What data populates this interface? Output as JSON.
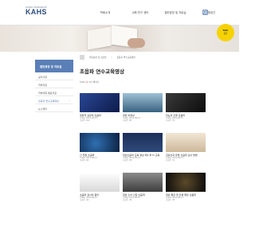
{
  "header": {
    "logo_sub": "KOREA AEROSPACE",
    "logo_main": "KAHS",
    "nav": [
      "학회소개",
      "교육·연구 센터",
      "열린광장 및 자료실",
      "회원공간"
    ]
  },
  "badge": {
    "line1": "talk",
    "line2": "상담"
  },
  "sidebar": {
    "title": "열린광장 및 자료실",
    "items": [
      {
        "label": "공지사항",
        "active": false
      },
      {
        "label": "학술자료",
        "active": false
      },
      {
        "label": "학술대회 발표자료",
        "active": false
      },
      {
        "label": "초등과 연수교육영상",
        "active": true
      },
      {
        "label": "뉴스레터",
        "active": false
      }
    ]
  },
  "breadcrumb": [
    "열린광장 및 자료실",
    "초등과 연수교육영상"
  ],
  "main": {
    "title": "초음파 연수교육영상",
    "total_label": "Total",
    "total_count": "12",
    "page_info": "1/2 페이지"
  },
  "cards": [
    {
      "title": "정상적 심장의 초음파",
      "meta1": "등록일: 2021.08.13",
      "meta2": "조회수: 102"
    },
    {
      "title": "정상 비정상",
      "meta1": "등록일: 2021.08.13",
      "meta2": "조회수: 85"
    },
    {
      "title": "당뇨의 신경 초음파",
      "meta1": "등록일: 2021.08.13",
      "meta2": "조회수: 74"
    },
    {
      "title": "간 질환 초음파",
      "meta1": "등록일: 2021.08.13",
      "meta2": "조회수: 66"
    },
    {
      "title": "임상초음파 교육 영상 제1 부 TI 교육",
      "meta1": "등록일: 2021.08.13",
      "meta2": "조회수: 58"
    },
    {
      "title": "갑상선과 유방 초음파 검사 방법",
      "meta1": "등록일: 2021.08.13",
      "meta2": "조회수: 51"
    },
    {
      "title": "초음파 검사의 원리",
      "meta1": "등록일: 2021.08.13",
      "meta2": "조회수: 44"
    },
    {
      "title": "정상 소아 신장 초음파",
      "meta1": "등록일: 2021.08.13",
      "meta2": "조회수: 39"
    },
    {
      "title": "정상 혈관 및 인체 혈관 초음파",
      "meta1": "등록일: 2021.08.13",
      "meta2": "조회수: 33"
    }
  ],
  "colors": {
    "primary": "#5a7fb7",
    "accent": "#c24a4a",
    "badge": "#f5d200"
  }
}
